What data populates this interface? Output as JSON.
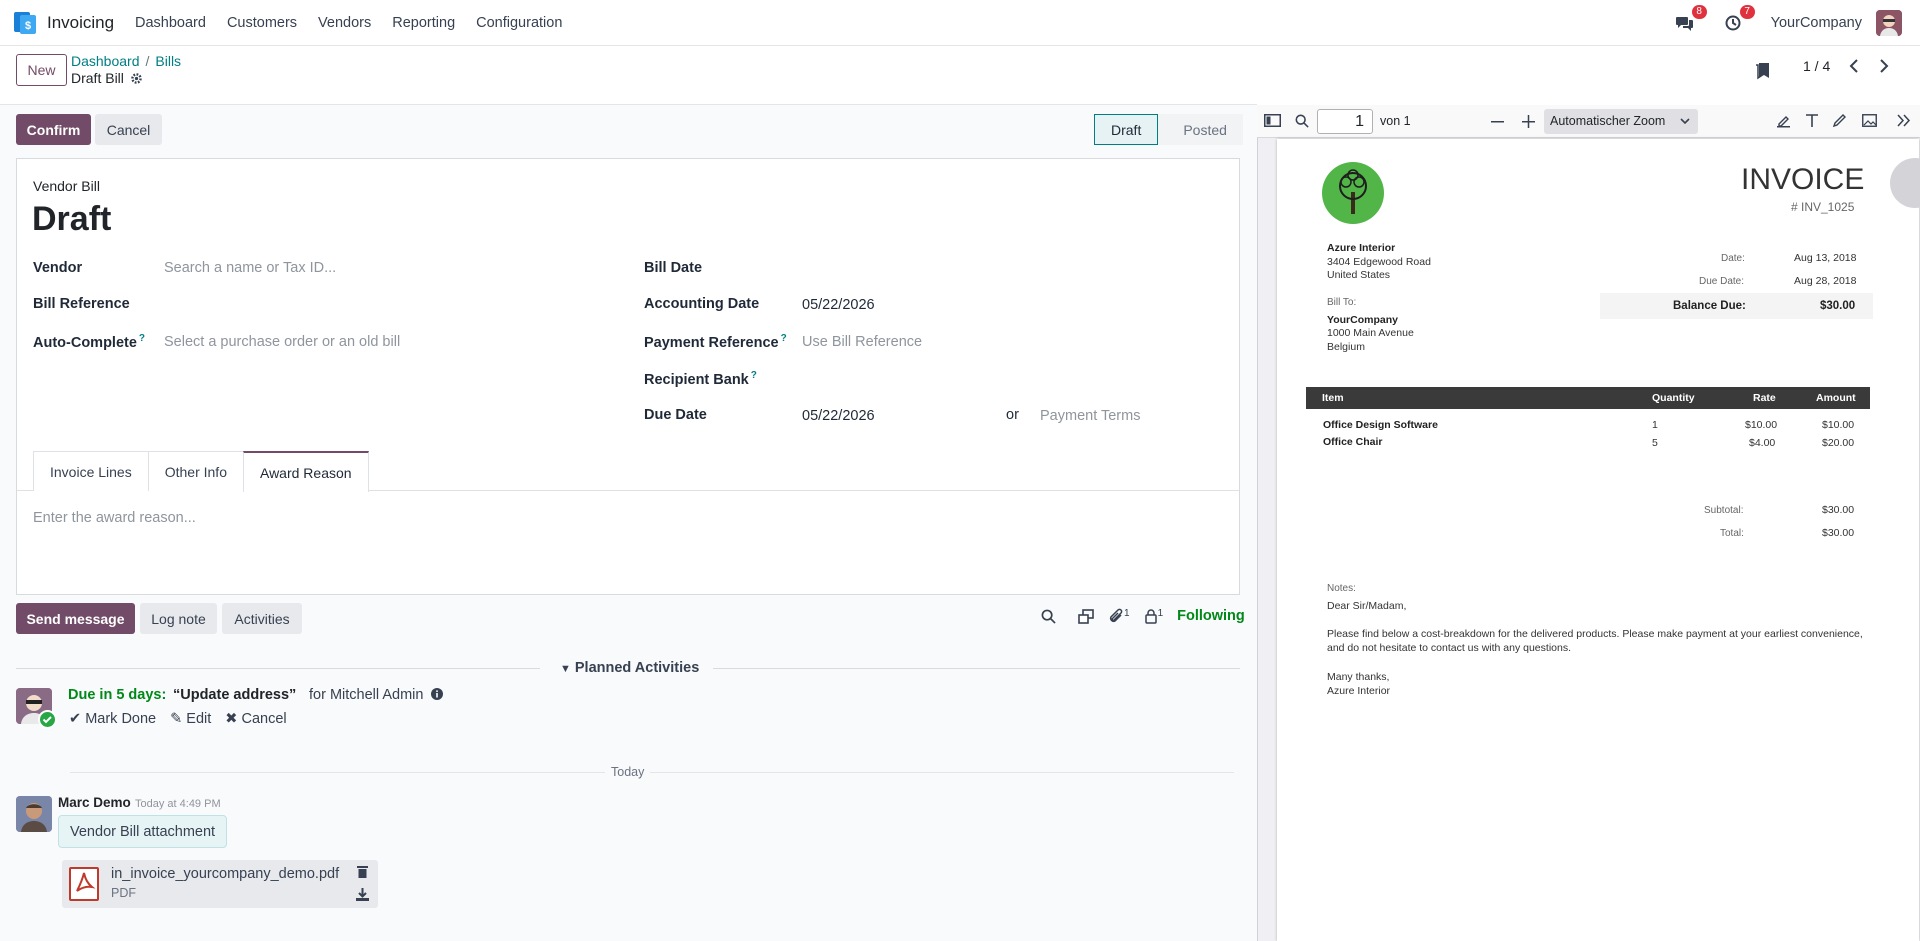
{
  "navbar": {
    "app_name": "Invoicing",
    "menu": [
      "Dashboard",
      "Customers",
      "Vendors",
      "Reporting",
      "Configuration"
    ],
    "messages_count": "8",
    "activities_count": "7",
    "company": "YourCompany"
  },
  "control_panel": {
    "new_label": "New",
    "breadcrumb": [
      "Dashboard",
      "Bills"
    ],
    "record_title": "Draft Bill",
    "pager": "1 / 4"
  },
  "actions": {
    "confirm": "Confirm",
    "cancel": "Cancel"
  },
  "statusbar": {
    "draft": "Draft",
    "posted": "Posted"
  },
  "form": {
    "doc_type": "Vendor Bill",
    "title": "Draft",
    "vendor_label": "Vendor",
    "vendor_placeholder": "Search a name or Tax ID...",
    "bill_ref_label": "Bill Reference",
    "autocomplete_label": "Auto-Complete",
    "autocomplete_placeholder": "Select a purchase order or an old bill",
    "bill_date_label": "Bill Date",
    "accounting_date_label": "Accounting Date",
    "accounting_date": "05/22/2026",
    "payment_ref_label": "Payment Reference",
    "payment_ref_placeholder": "Use Bill Reference",
    "recipient_bank_label": "Recipient Bank",
    "due_date_label": "Due Date",
    "due_date": "05/22/2026",
    "or": "or",
    "payment_terms_placeholder": "Payment Terms",
    "help_mark": "?"
  },
  "tabs": [
    "Invoice Lines",
    "Other Info",
    "Award Reason"
  ],
  "award_placeholder": "Enter the award reason...",
  "chatter": {
    "send_message": "Send message",
    "log_note": "Log note",
    "activities": "Activities",
    "attachments_count": "1",
    "followers_count": "1",
    "following": "Following",
    "planned_title": "Planned Activities",
    "activity": {
      "due": "Due in 5 days:",
      "name": "“Update address”",
      "for": "for Mitchell Admin",
      "mark_done": "Mark Done",
      "edit": "Edit",
      "cancel": "Cancel"
    },
    "today": "Today",
    "message": {
      "author": "Marc Demo",
      "time": "Today at 4:49 PM",
      "body": "Vendor Bill attachment",
      "attachment_name": "in_invoice_yourcompany_demo.pdf",
      "attachment_type": "PDF"
    }
  },
  "pdf_viewer": {
    "page": "1",
    "of_pages": "von 1",
    "zoom": "Automatischer Zoom"
  },
  "invoice": {
    "title": "INVOICE",
    "number": "# INV_1025",
    "from_name": "Azure Interior",
    "from_addr1": "3404 Edgewood Road",
    "from_addr2": "United States",
    "bill_to_label": "Bill To:",
    "to_name": "YourCompany",
    "to_addr1": "1000 Main Avenue",
    "to_addr2": "Belgium",
    "date_label": "Date:",
    "date": "Aug 13, 2018",
    "due_label": "Due Date:",
    "due": "Aug 28, 2018",
    "balance_label": "Balance Due:",
    "balance": "$30.00",
    "columns": [
      "Item",
      "Quantity",
      "Rate",
      "Amount"
    ],
    "lines": [
      {
        "item": "Office Design Software",
        "qty": "1",
        "rate": "$10.00",
        "amount": "$10.00"
      },
      {
        "item": "Office Chair",
        "qty": "5",
        "rate": "$4.00",
        "amount": "$20.00"
      }
    ],
    "subtotal_label": "Subtotal:",
    "subtotal": "$30.00",
    "total_label": "Total:",
    "total": "$30.00",
    "notes_label": "Notes:",
    "notes_greeting": "Dear Sir/Madam,",
    "notes_body1": "Please find below a cost-breakdown for the delivered products. Please make payment at your earliest convenience,",
    "notes_body2": "and do not hesitate to contact us with any questions.",
    "notes_thanks": "Many thanks,",
    "notes_sign": "Azure Interior"
  }
}
